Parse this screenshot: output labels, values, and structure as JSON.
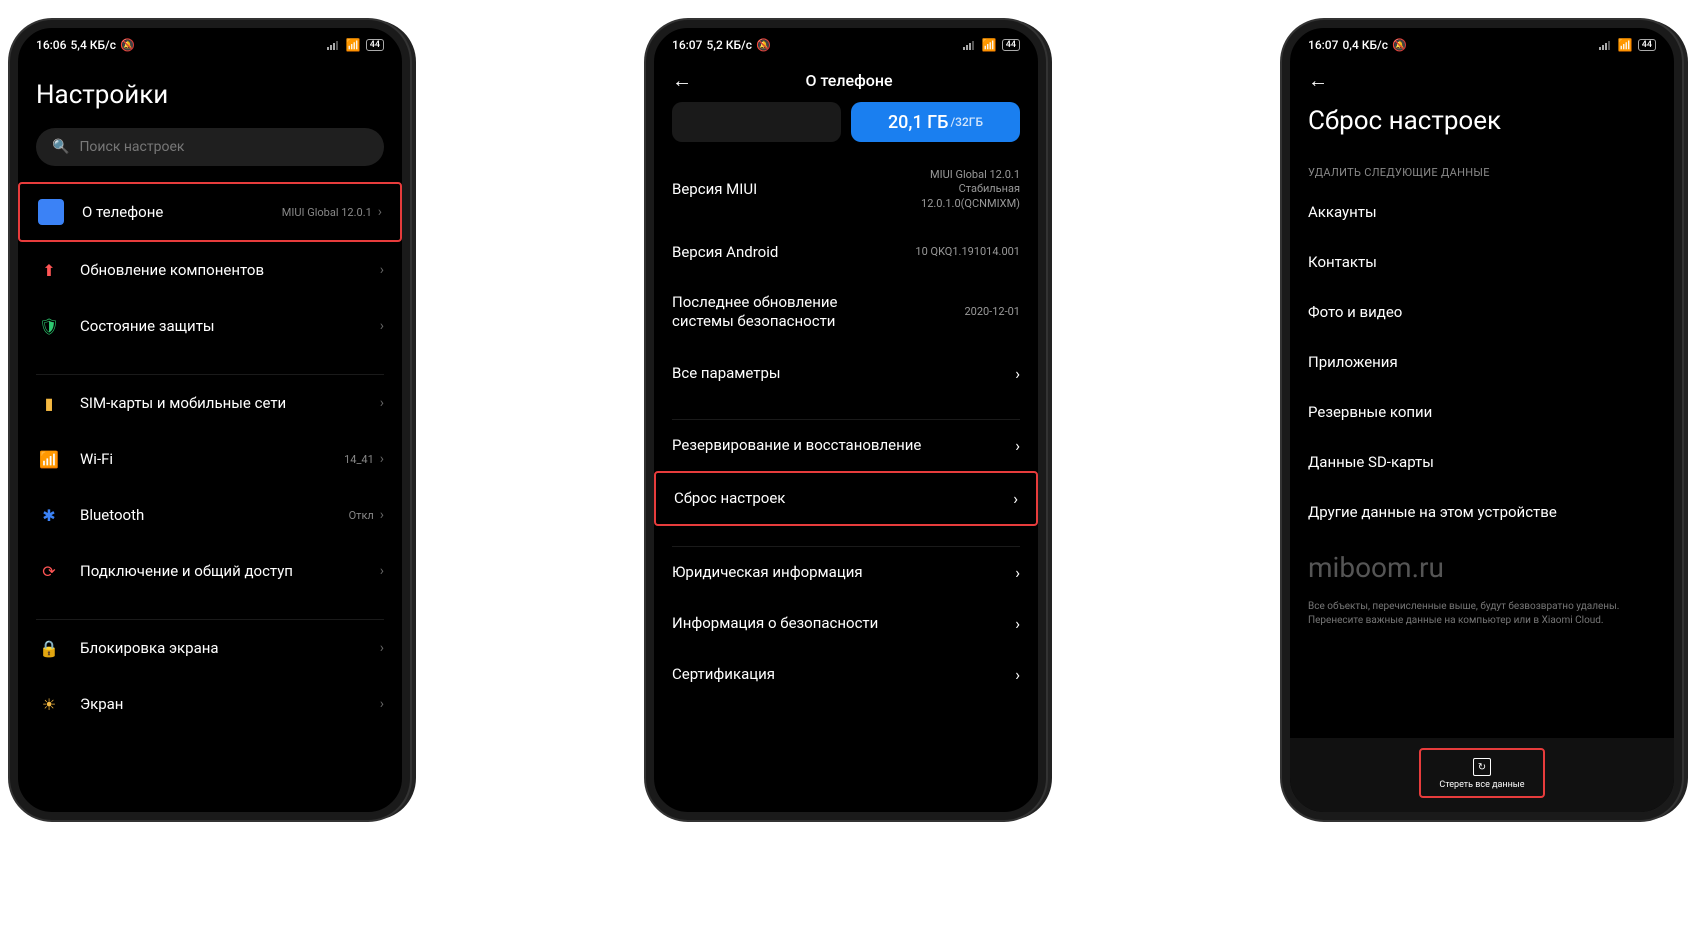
{
  "phone1": {
    "status": {
      "time": "16:06",
      "speed": "5,4 КБ/с",
      "battery": "44"
    },
    "title": "Настройки",
    "search_placeholder": "Поиск настроек",
    "rows": {
      "about": {
        "label": "О телефоне",
        "value": "MIUI Global 12.0.1"
      },
      "update": {
        "label": "Обновление компонентов"
      },
      "security": {
        "label": "Состояние защиты"
      },
      "sim": {
        "label": "SIM-карты и мобильные сети"
      },
      "wifi": {
        "label": "Wi-Fi",
        "value": "14_41"
      },
      "bt": {
        "label": "Bluetooth",
        "value": "Откл"
      },
      "share": {
        "label": "Подключение и общий доступ"
      },
      "lock": {
        "label": "Блокировка экрана"
      },
      "display": {
        "label": "Экран"
      }
    }
  },
  "phone2": {
    "status": {
      "time": "16:07",
      "speed": "5,2 КБ/с",
      "battery": "44"
    },
    "header": "О телефоне",
    "storage": {
      "used": "20,1 ГБ",
      "total": "/32ГБ"
    },
    "info": {
      "miui": {
        "label": "Версия MIUI",
        "value": "MIUI Global 12.0.1\nСтабильная\n12.0.1.0(QCNMIXM)"
      },
      "android": {
        "label": "Версия Android",
        "value": "10 QKQ1.191014.001"
      },
      "security_update": {
        "label": "Последнее обновление системы безопасности",
        "value": "2020-12-01"
      },
      "all_params": {
        "label": "Все параметры"
      },
      "backup": {
        "label": "Резервирование и восстановление"
      },
      "reset": {
        "label": "Сброс настроек"
      },
      "legal": {
        "label": "Юридическая информация"
      },
      "safety": {
        "label": "Информация о безопасности"
      },
      "cert": {
        "label": "Сертификация"
      }
    }
  },
  "phone3": {
    "status": {
      "time": "16:07",
      "speed": "0,4 КБ/с",
      "battery": "44"
    },
    "title": "Сброс настроек",
    "section_label": "УДАЛИТЬ СЛЕДУЮЩИЕ ДАННЫЕ",
    "items": {
      "accounts": "Аккаунты",
      "contacts": "Контакты",
      "media": "Фото и видео",
      "apps": "Приложения",
      "backups": "Резервные копии",
      "sd": "Данные SD-карты",
      "other": "Другие данные на этом устройстве"
    },
    "watermark": "miboom.ru",
    "footnote": "Все объекты, перечисленные выше, будут безвозвратно удалены. Перенесите важные данные на компьютер или в Xiaomi Cloud.",
    "erase": "Стереть все данные"
  }
}
